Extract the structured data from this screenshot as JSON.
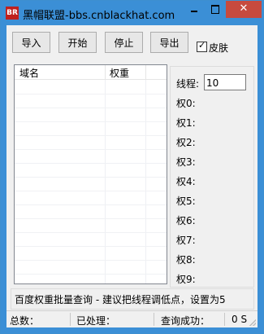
{
  "window": {
    "title": "黑帽联盟-bbs.cnblackhat.com",
    "icon_text": "BR",
    "icon_color": "#c0201d",
    "titlebar_color": "#3b8fd6"
  },
  "title_controls": {
    "close_glyph": "✕"
  },
  "toolbar": {
    "import_label": "导入",
    "start_label": "开始",
    "stop_label": "停止",
    "export_label": "导出",
    "skin_label": "皮肤",
    "skin_checked": true
  },
  "list": {
    "columns": [
      "域名",
      "权重"
    ],
    "rows": []
  },
  "panel": {
    "threads_label": "线程:",
    "threads_value": "10",
    "weights": [
      "权0:",
      "权1:",
      "权2:",
      "权3:",
      "权4:",
      "权5:",
      "权6:",
      "权7:",
      "权8:",
      "权9:"
    ]
  },
  "status_message": "百度权重批量查询 - 建议把线程调低点，设置为5",
  "statusbar": {
    "total_label": "总数：",
    "processed_label": "已处理：",
    "success_label": "查询成功：",
    "time_value": "0 S"
  }
}
